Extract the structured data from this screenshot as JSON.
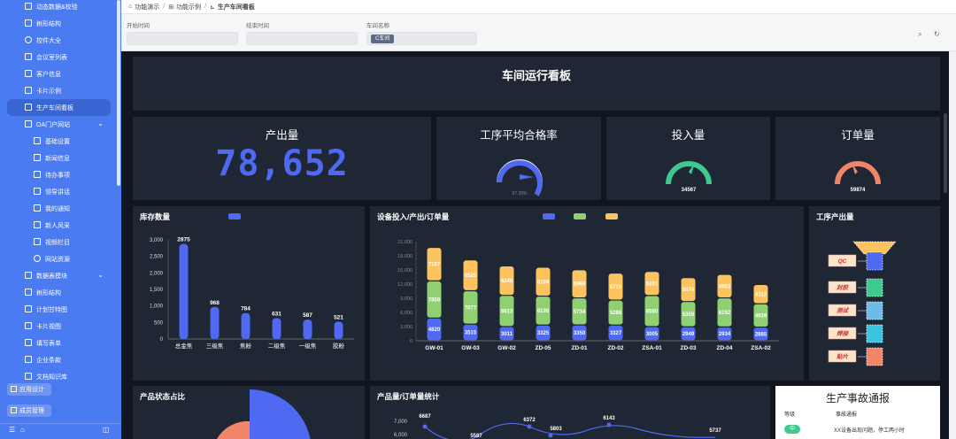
{
  "sidebar": {
    "items": [
      {
        "label": "动态数据&校验",
        "icon": "grid-icon",
        "level": 1
      },
      {
        "label": "树形结构",
        "icon": "grid-icon",
        "level": 1
      },
      {
        "label": "控件大全",
        "icon": "circle-icon",
        "level": 1
      },
      {
        "label": "会议室列表",
        "icon": "grid-icon",
        "level": 1
      },
      {
        "label": "客户信息",
        "icon": "grid-icon",
        "level": 1
      },
      {
        "label": "卡片示例",
        "icon": "grid-icon",
        "level": 1
      },
      {
        "label": "生产车间看板",
        "icon": "chart-icon",
        "level": 1,
        "active": true
      },
      {
        "label": "OA门户网站",
        "icon": "home-icon",
        "level": 1,
        "expand": true
      },
      {
        "label": "基础设置",
        "icon": "grid-icon",
        "level": 2
      },
      {
        "label": "新闻信息",
        "icon": "grid-icon",
        "level": 2
      },
      {
        "label": "待办事项",
        "icon": "grid-icon",
        "level": 2
      },
      {
        "label": "领导讲话",
        "icon": "grid-icon",
        "level": 2
      },
      {
        "label": "我的通知",
        "icon": "grid-icon",
        "level": 2
      },
      {
        "label": "新人风采",
        "icon": "grid-icon",
        "level": 2
      },
      {
        "label": "视频栏目",
        "icon": "grid-icon",
        "level": 2
      },
      {
        "label": "网站资源",
        "icon": "circle-icon",
        "level": 2
      },
      {
        "label": "数据表模块",
        "icon": "dots-icon",
        "level": 1,
        "expand": true
      },
      {
        "label": "树形结构",
        "icon": "grid-icon",
        "level": 1
      },
      {
        "label": "计划甘特图",
        "icon": "grid-icon",
        "level": 1
      },
      {
        "label": "卡片视图",
        "icon": "grid-icon",
        "level": 1
      },
      {
        "label": "填写表单",
        "icon": "grid-icon",
        "level": 1
      },
      {
        "label": "企业条款",
        "icon": "grid-icon",
        "level": 1
      },
      {
        "label": "文档知识库",
        "icon": "grid-icon",
        "level": 1
      }
    ],
    "app_design": "应用设计",
    "perm_manage": "成员管理"
  },
  "breadcrumb": {
    "home": "功能演示",
    "mid": "功能示例",
    "current": "生产车间看板"
  },
  "filters": {
    "start_label": "开始时间",
    "end_label": "结束时间",
    "workshop_label": "车间名称",
    "workshop_tag": "C车间"
  },
  "dashboard": {
    "title": "车间运行看板",
    "kpi": {
      "output_title": "产出量",
      "output_value": "78,652",
      "pass_title": "工序平均合格率",
      "pass_value": "87.28%",
      "input_title": "投入量",
      "input_value": "34567",
      "order_title": "订单量",
      "order_value": "59874"
    },
    "colors": {
      "blue": "#4f69f2",
      "green": "#8fd172",
      "yellow": "#fcc35f",
      "orange": "#f0856a",
      "teal": "#3ec98f",
      "cyan": "#3bc4e2",
      "lightblue": "#6fbbe7"
    },
    "process_title": "工序产出量",
    "process_steps": [
      "QC",
      "封胶",
      "测试",
      "焊接",
      "贴片"
    ],
    "status_title": "产品状态占比",
    "bottom_chart_title": "产品量/订单量统计",
    "bottom_points": [
      "6687",
      "6372",
      "5803",
      "6143",
      "5737",
      "5587"
    ],
    "bottom_ticks": [
      "7,000",
      "6,000"
    ],
    "notice": {
      "title": "生产事故通报",
      "col1": "等级",
      "col2": "事故通报",
      "level": "中",
      "text": "XX设备出现问题，停工两小时"
    }
  },
  "chart_data": [
    {
      "type": "bar",
      "title": "库存数量",
      "categories": [
        "总金焦",
        "三级焦",
        "焦粉",
        "二级焦",
        "一级焦",
        "胶粉"
      ],
      "values": [
        2875,
        968,
        784,
        631,
        587,
        521
      ],
      "ylim": [
        0,
        3000
      ],
      "yticks": [
        "0",
        "500",
        "1,000",
        "1,500",
        "2,000",
        "2,500",
        "3,000"
      ]
    },
    {
      "type": "bar",
      "title": "设备投入/产出/订单量",
      "categories": [
        "GW-01",
        "GW-03",
        "GW-02",
        "ZD-05",
        "ZD-01",
        "ZD-02",
        "ZSA-01",
        "ZD-03",
        "ZD-04",
        "ZSA-02"
      ],
      "series": [
        {
          "values": [
            4820,
            3515,
            3011,
            3325,
            3350,
            3327,
            3005,
            2949,
            2934,
            2885
          ]
        },
        {
          "values": [
            7858,
            7077,
            6613,
            6136,
            5734,
            5286,
            6580,
            5359,
            6152,
            4939
          ]
        },
        {
          "values": [
            7107,
            6525,
            6240,
            6109,
            5969,
            5715,
            5101,
            5074,
            4983,
            4112
          ]
        }
      ],
      "ylim": [
        0,
        21000
      ],
      "yticks": [
        "0",
        "3,000",
        "6,000",
        "9,000",
        "12,000",
        "15,000",
        "18,000",
        "21,000"
      ]
    }
  ]
}
